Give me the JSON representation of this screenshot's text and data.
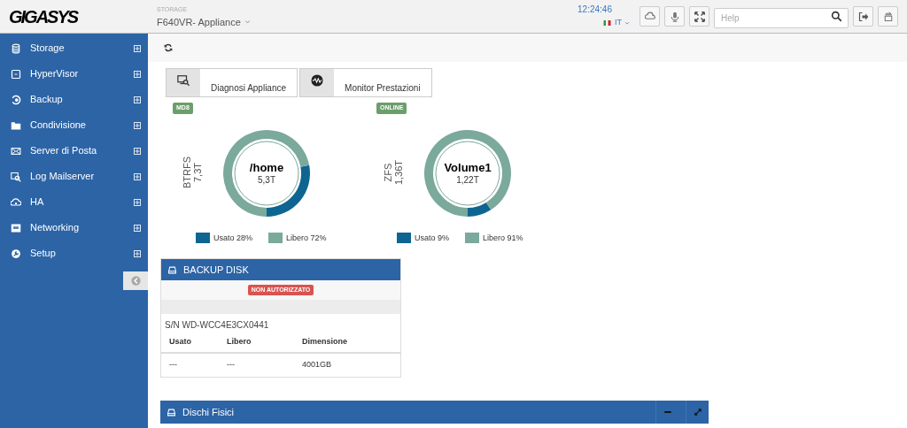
{
  "header": {
    "logo": "GIGASYS",
    "section_label": "STORAGE",
    "device": "F640VR- Appliance",
    "clock": "12:24:46",
    "language": "IT",
    "search": {
      "placeholder": "Help"
    }
  },
  "sidebar": {
    "items": [
      {
        "label": "Storage"
      },
      {
        "label": "HyperVisor"
      },
      {
        "label": "Backup"
      },
      {
        "label": "Condivisione"
      },
      {
        "label": "Server di Posta"
      },
      {
        "label": "Log Mailserver"
      },
      {
        "label": "HA"
      },
      {
        "label": "Networking"
      },
      {
        "label": "Setup"
      }
    ]
  },
  "tools": [
    {
      "label": "Diagnosi Appliance"
    },
    {
      "label": "Monitor Prestazioni"
    }
  ],
  "volumes": [
    {
      "badge": "MD8",
      "filesystem": "BTRFS",
      "capacity": "7,3T",
      "name": "/home",
      "size": "5,3T",
      "chart_data": {
        "type": "donut",
        "categories": [
          "Usato",
          "Libero"
        ],
        "values": [
          28,
          72
        ]
      },
      "legend": [
        {
          "value_label": "28%",
          "color": "#0f6591"
        },
        {
          "value_label": "72%",
          "color": "#7ba99c"
        }
      ]
    },
    {
      "badge": "ONLINE",
      "filesystem": "ZFS",
      "capacity": "1,36T",
      "name": "Volume1",
      "size": "1,22T",
      "chart_data": {
        "type": "donut",
        "categories": [
          "Usato",
          "Libero"
        ],
        "values": [
          9,
          91
        ]
      },
      "legend": [
        {
          "value_label": "9%",
          "color": "#0f6591"
        },
        {
          "value_label": "91%",
          "color": "#7ba99c"
        }
      ]
    }
  ],
  "backup_disk": {
    "title": "BACKUP DISK",
    "status": "NON AUTORIZZATO",
    "serial": "S/N WD-WCC4E3CX0441",
    "columns": [
      "Usato",
      "Libero",
      "Dimensione"
    ],
    "rows": [
      [
        "---",
        "---",
        "4001GB"
      ]
    ]
  },
  "physical_disks": {
    "title": "Dischi Fisici"
  }
}
